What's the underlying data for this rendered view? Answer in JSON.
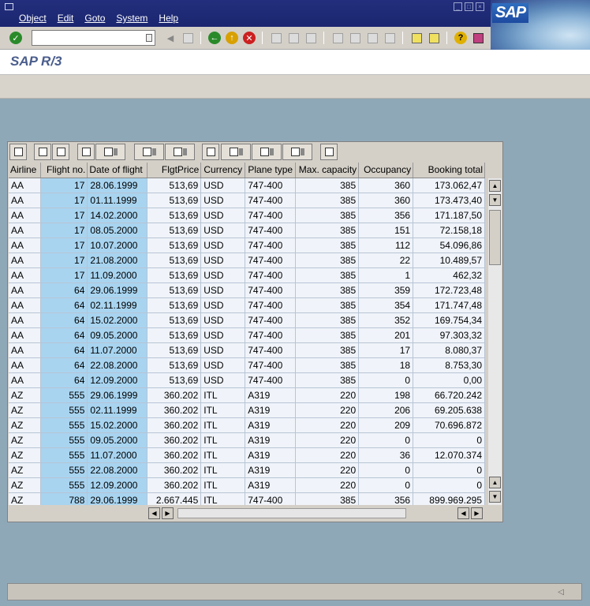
{
  "menu": [
    "Object",
    "Edit",
    "Goto",
    "System",
    "Help"
  ],
  "logo": "SAP",
  "command_field": {
    "value": ""
  },
  "page_title": "SAP R/3",
  "colors": {
    "title_bar": "#1b2670",
    "key_column": "#a8d4f0",
    "row_bg": "#f0f4fa",
    "desktop": "#8fa8b8"
  },
  "toolbar_icons": [
    "enter-icon",
    "back-icon",
    "exit-icon",
    "cancel-icon",
    "print-icon",
    "find-icon",
    "help-icon"
  ],
  "table": {
    "columns": [
      "Airline",
      "Flight no.",
      "Date of flight",
      "FlgtPrice",
      "Currency",
      "Plane type",
      "Max. capacity",
      "Occupancy",
      "Booking total"
    ],
    "rows": [
      [
        "AA",
        "17",
        "28.06.1999",
        "513,69",
        "USD",
        "747-400",
        "385",
        "360",
        "173.062,47"
      ],
      [
        "AA",
        "17",
        "01.11.1999",
        "513,69",
        "USD",
        "747-400",
        "385",
        "360",
        "173.473,40"
      ],
      [
        "AA",
        "17",
        "14.02.2000",
        "513,69",
        "USD",
        "747-400",
        "385",
        "356",
        "171.187,50"
      ],
      [
        "AA",
        "17",
        "08.05.2000",
        "513,69",
        "USD",
        "747-400",
        "385",
        "151",
        "72.158,18"
      ],
      [
        "AA",
        "17",
        "10.07.2000",
        "513,69",
        "USD",
        "747-400",
        "385",
        "112",
        "54.096,86"
      ],
      [
        "AA",
        "17",
        "21.08.2000",
        "513,69",
        "USD",
        "747-400",
        "385",
        "22",
        "10.489,57"
      ],
      [
        "AA",
        "17",
        "11.09.2000",
        "513,69",
        "USD",
        "747-400",
        "385",
        "1",
        "462,32"
      ],
      [
        "AA",
        "64",
        "29.06.1999",
        "513,69",
        "USD",
        "747-400",
        "385",
        "359",
        "172.723,48"
      ],
      [
        "AA",
        "64",
        "02.11.1999",
        "513,69",
        "USD",
        "747-400",
        "385",
        "354",
        "171.747,48"
      ],
      [
        "AA",
        "64",
        "15.02.2000",
        "513,69",
        "USD",
        "747-400",
        "385",
        "352",
        "169.754,34"
      ],
      [
        "AA",
        "64",
        "09.05.2000",
        "513,69",
        "USD",
        "747-400",
        "385",
        "201",
        "97.303,32"
      ],
      [
        "AA",
        "64",
        "11.07.2000",
        "513,69",
        "USD",
        "747-400",
        "385",
        "17",
        "8.080,37"
      ],
      [
        "AA",
        "64",
        "22.08.2000",
        "513,69",
        "USD",
        "747-400",
        "385",
        "18",
        "8.753,30"
      ],
      [
        "AA",
        "64",
        "12.09.2000",
        "513,69",
        "USD",
        "747-400",
        "385",
        "0",
        "0,00"
      ],
      [
        "AZ",
        "555",
        "29.06.1999",
        "360.202",
        "ITL",
        "A319",
        "220",
        "198",
        "66.720.242"
      ],
      [
        "AZ",
        "555",
        "02.11.1999",
        "360.202",
        "ITL",
        "A319",
        "220",
        "206",
        "69.205.638"
      ],
      [
        "AZ",
        "555",
        "15.02.2000",
        "360.202",
        "ITL",
        "A319",
        "220",
        "209",
        "70.696.872"
      ],
      [
        "AZ",
        "555",
        "09.05.2000",
        "360.202",
        "ITL",
        "A319",
        "220",
        "0",
        "0"
      ],
      [
        "AZ",
        "555",
        "11.07.2000",
        "360.202",
        "ITL",
        "A319",
        "220",
        "36",
        "12.070.374"
      ],
      [
        "AZ",
        "555",
        "22.08.2000",
        "360.202",
        "ITL",
        "A319",
        "220",
        "0",
        "0"
      ],
      [
        "AZ",
        "555",
        "12.09.2000",
        "360.202",
        "ITL",
        "A319",
        "220",
        "0",
        "0"
      ],
      [
        "AZ",
        "788",
        "29.06.1999",
        "2.667.445",
        "ITL",
        "747-400",
        "385",
        "356",
        "899.969.295"
      ]
    ]
  }
}
